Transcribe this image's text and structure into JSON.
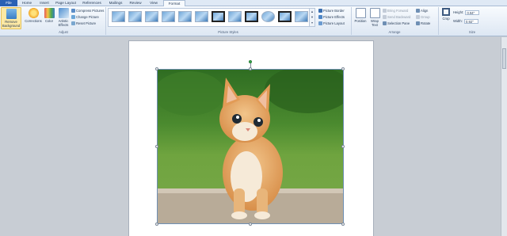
{
  "tabs": [
    {
      "label": "File",
      "kind": "file"
    },
    {
      "label": "Home"
    },
    {
      "label": "Insert"
    },
    {
      "label": "Page Layout"
    },
    {
      "label": "References"
    },
    {
      "label": "Mailings"
    },
    {
      "label": "Review"
    },
    {
      "label": "View"
    },
    {
      "label": "Format",
      "kind": "active"
    }
  ],
  "ribbon": {
    "remove_background": "Remove Background",
    "corrections": "Corrections",
    "color": "Color",
    "artistic_effects": "Artistic Effects",
    "compress": "Compress Pictures",
    "change": "Change Picture",
    "reset": "Reset Picture",
    "adjust_label": "Adjust",
    "picture_styles_label": "Picture Styles",
    "picture_border": "Picture Border",
    "picture_effects": "Picture Effects",
    "picture_layout": "Picture Layout",
    "position": "Position",
    "wrap_text": "Wrap Text",
    "bring_forward": "Bring Forward",
    "send_backward": "Send Backward",
    "selection_pane": "Selection Pane",
    "align": "Align",
    "group": "Group",
    "rotate": "Rotate",
    "arrange_label": "Arrange",
    "crop": "Crop",
    "height_label": "Height:",
    "height_value": "0.94\"",
    "width_label": "Width:",
    "width_value": "0.92\"",
    "size_label": "Size"
  },
  "colors": {
    "file_tab": "#2a61b4",
    "ribbon_bg": "#dde7f3",
    "workspace": "#c8cdd4"
  }
}
